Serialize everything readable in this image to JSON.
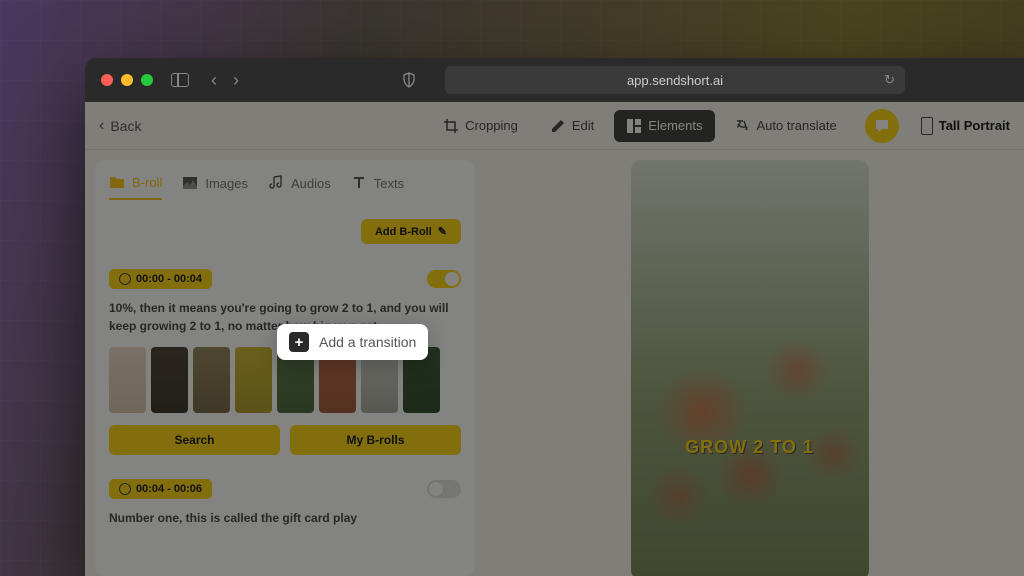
{
  "browser": {
    "url": "app.sendshort.ai"
  },
  "topbar": {
    "back": "Back",
    "cropping": "Cropping",
    "edit": "Edit",
    "elements": "Elements",
    "auto_translate": "Auto translate",
    "aspect": "Tall Portrait"
  },
  "tabs": {
    "broll": "B-roll",
    "images": "Images",
    "audios": "Audios",
    "texts": "Texts"
  },
  "add_broll": "Add B-Roll",
  "tooltip": "Add a transition",
  "seg1": {
    "time": "00:00 - 00:04",
    "text": "10%, then it means you're going to grow 2 to 1, and you will keep growing 2 to 1, no matter how big you get",
    "search": "Search",
    "my": "My B-rolls"
  },
  "seg2": {
    "time": "00:04 - 00:06",
    "text": "Number one, this is called the gift card play"
  },
  "preview": {
    "caption": "GROW 2 TO 1"
  }
}
